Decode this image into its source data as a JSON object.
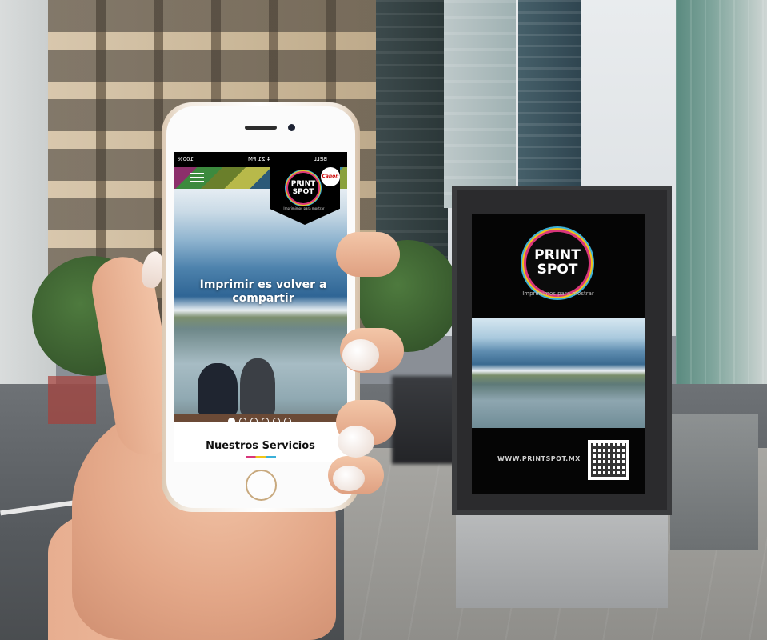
{
  "phone": {
    "status": {
      "battery": "100%",
      "time": "4:21 PM",
      "carrier": "BELL"
    },
    "brand": {
      "logo_line1": "PRINT",
      "logo_line2": "SPOT",
      "tagline": "Imprimimos para mostrar",
      "partner": "Canon"
    },
    "hero": {
      "title": "Imprimir es volver a compartir",
      "slide_count": 6,
      "active_slide": 1
    },
    "section": {
      "title": "Nuestros Servicios"
    }
  },
  "billboard": {
    "logo_line1": "PRINT",
    "logo_line2": "SPOT",
    "tagline": "Imprimimos para mostrar",
    "url": "WWW.PRINTSPOT.MX"
  },
  "colors": {
    "brand_magenta": "#d9367b",
    "brand_yellow": "#f0c419",
    "brand_cyan": "#3bb0d8"
  },
  "icons": {
    "menu": "hamburger-icon",
    "wifi": "wifi-icon",
    "battery": "battery-icon"
  }
}
